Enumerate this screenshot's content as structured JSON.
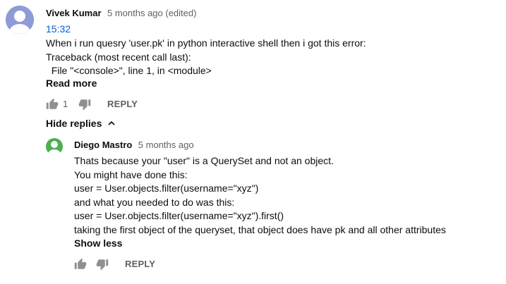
{
  "comment": {
    "author": "Vivek Kumar",
    "meta": "5 months ago (edited)",
    "timestamp_link": "15:32",
    "lines": [
      "When i run quesry 'user.pk' in python interactive shell then i got this error:",
      "Traceback (most recent call last):",
      "  File \"<console>\", line 1, in <module>"
    ],
    "read_more": "Read more",
    "like_count": "1",
    "reply_label": "REPLY",
    "avatar_color": "#8e9bd6"
  },
  "replies_toggle": {
    "label": "Hide replies"
  },
  "reply": {
    "author": "Diego Mastro",
    "meta": "5 months ago",
    "lines": [
      "Thats because your \"user\" is a QuerySet and not an object.",
      "You might have done this:",
      "user = User.objects.filter(username=\"xyz\")",
      "and what you needed to do was this:",
      "user = User.objects.filter(username=\"xyz\").first()",
      "taking the first object of the queryset, that object does have pk and all other attributes"
    ],
    "show_less": "Show less",
    "reply_label": "REPLY",
    "avatar_color": "#4caf50"
  },
  "colors": {
    "link": "#065fd4",
    "secondary_text": "#606060",
    "icon": "#909090"
  },
  "icons": {
    "like": "thumbs-up-icon",
    "dislike": "thumbs-down-icon",
    "chevron": "chevron-up-icon"
  }
}
